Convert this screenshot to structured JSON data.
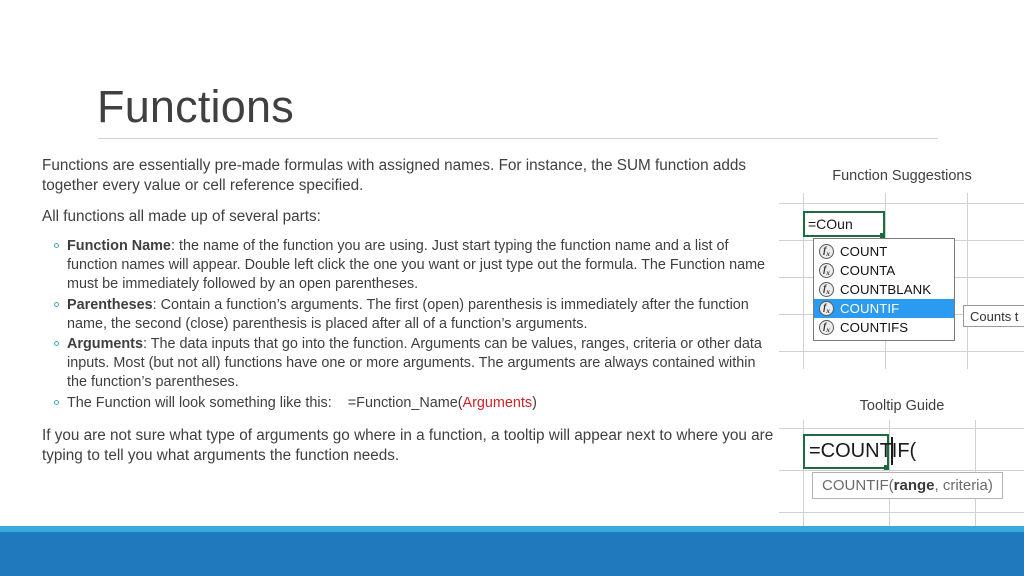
{
  "slide": {
    "title": "Functions",
    "intro_paragraph": "Functions are essentially pre-made formulas with assigned names. For instance, the SUM function adds together every value or cell reference specified.",
    "parts_lead": "All functions all made up of several parts:",
    "closing_paragraph": "If you are not sure what type of arguments go where in a function, a tooltip will appear next to where you are typing to tell you what arguments the function needs."
  },
  "bullets": [
    {
      "term": "Function Name",
      "text": ": the name of the function you are using. Just start typing the function name and a list of function names will appear. Double left click the one you want or just type out the formula. The Function name must be immediately followed by an open parentheses."
    },
    {
      "term": "Parentheses",
      "text": ": Contain a function’s arguments. The first (open) parenthesis is immediately after the function name, the second (close) parenthesis is placed after all of a function’s arguments."
    },
    {
      "term": "Arguments",
      "text": ": The data inputs that go into the function. Arguments can be values, ranges, criteria or other data inputs. Most (but not all) functions have one or more arguments. The arguments are always contained within the function’s parentheses."
    }
  ],
  "example_bullet": {
    "lead": "The Function will look something like this:",
    "spacer": "    ",
    "formula_prefix": "=Function_Name(",
    "formula_arguments": "Arguments",
    "formula_suffix": ")",
    "arguments_color": "#d31f26"
  },
  "figures": {
    "suggestions": {
      "caption": "Function Suggestions",
      "cell_value": "=COun",
      "items": [
        {
          "icon": "fx-icon",
          "label": "COUNT",
          "selected": false
        },
        {
          "icon": "fx-icon",
          "label": "COUNTA",
          "selected": false
        },
        {
          "icon": "fx-icon",
          "label": "COUNTBLANK",
          "selected": false
        },
        {
          "icon": "fx-icon",
          "label": "COUNTIF",
          "selected": true
        },
        {
          "icon": "fx-icon",
          "label": "COUNTIFS",
          "selected": false
        }
      ],
      "hint_tooltip": "Counts t",
      "selected_highlight_color": "#2a9bf0",
      "cell_border_color": "#1e6b3f"
    },
    "tooltip_guide": {
      "caption": "Tooltip Guide",
      "cell_value": "=COUNTIF(",
      "signature_prefix": "COUNTIF(",
      "signature_arg_bold": "range",
      "signature_rest": ", criteria)",
      "cell_border_color": "#1e6b3f"
    }
  },
  "banner": {
    "accent_color": "#3aa9dd",
    "main_color": "#2079bd"
  }
}
